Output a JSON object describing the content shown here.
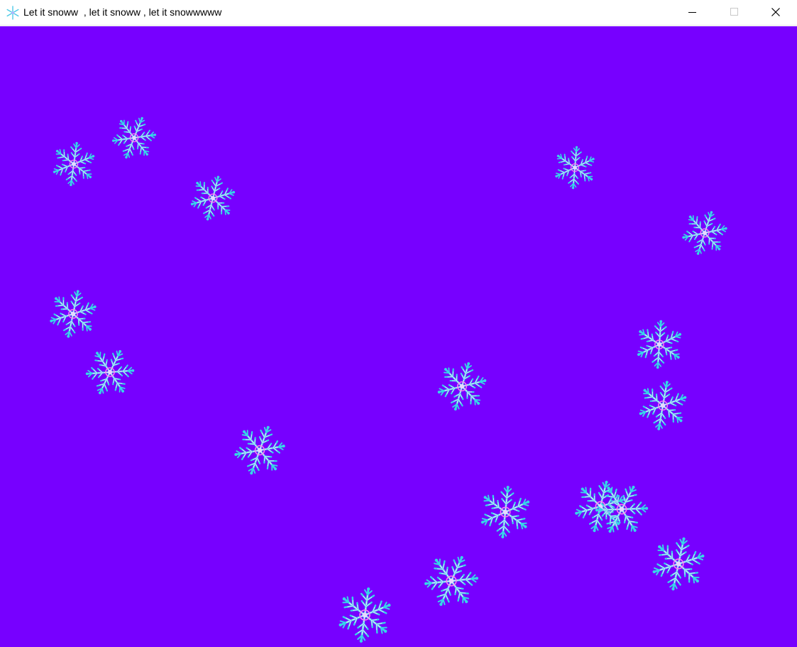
{
  "window": {
    "title": "Let it snoww  , let it snoww , let it snowwwww",
    "icon": "snowflake-icon",
    "controls": {
      "minimize_icon": "minimize-icon",
      "maximize_icon": "maximize-icon",
      "close_icon": "close-icon"
    }
  },
  "scene": {
    "background_color": "#7700ff",
    "snowflake_icon": "snowflake-icon",
    "snowflake_colors": {
      "outer": "#36d6e8",
      "inner": "#e8d8ff",
      "core": "#ff7df2"
    }
  }
}
